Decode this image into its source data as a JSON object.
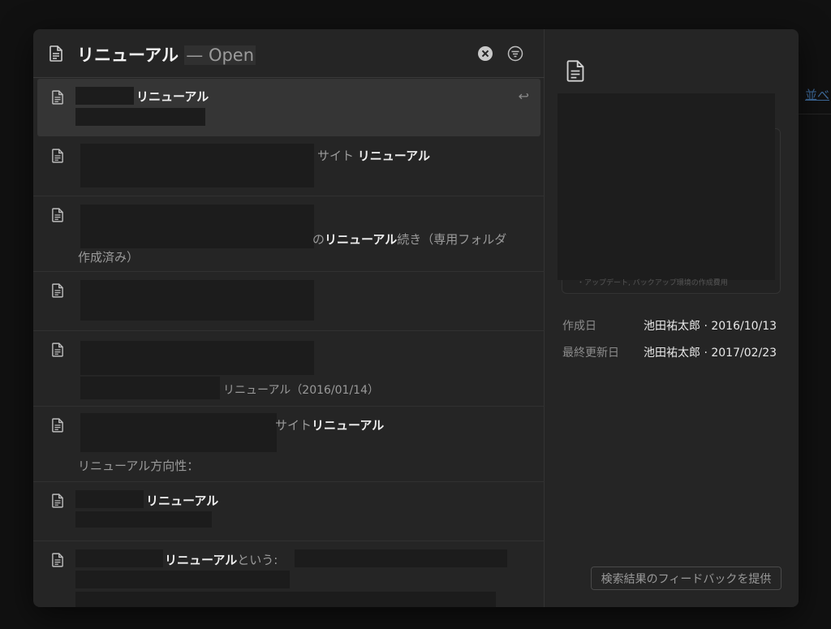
{
  "background": {
    "title": "",
    "sort_link": "並べ"
  },
  "search": {
    "query": "リニューアル",
    "suffix": "— Open",
    "icons": {
      "doc": "document-icon",
      "clear": "clear-circle-icon",
      "filter": "filter-icon"
    }
  },
  "results": [
    {
      "line1_bold": "リニューアル",
      "enter": "↩"
    },
    {
      "line1_pre": "サイト ",
      "line1_bold": "リニューアル"
    },
    {
      "line2_pre": "の",
      "line2_bold": "リニューアル",
      "line2_post": "続き（専用フォルダ",
      "line3": "作成済み）"
    },
    {},
    {
      "line3": "リニューアル（2016/01/14）"
    },
    {
      "line1_pre": "サイト",
      "line1_bold": "リニューアル",
      "line3": "リニューアル方向性："
    },
    {
      "line1_bold": "リニューアル"
    },
    {
      "line1_bold": "リニューアル",
      "line1_post": "という:"
    }
  ],
  "preview": {
    "snippet": "・アップデート, バックアップ環境の作成費用",
    "created_label": "作成日",
    "created_value": "池田祐太郎 · 2016/10/13",
    "updated_label": "最終更新日",
    "updated_value": "池田祐太郎 · 2017/02/23",
    "feedback_button": "検索結果のフィードバックを提供"
  }
}
